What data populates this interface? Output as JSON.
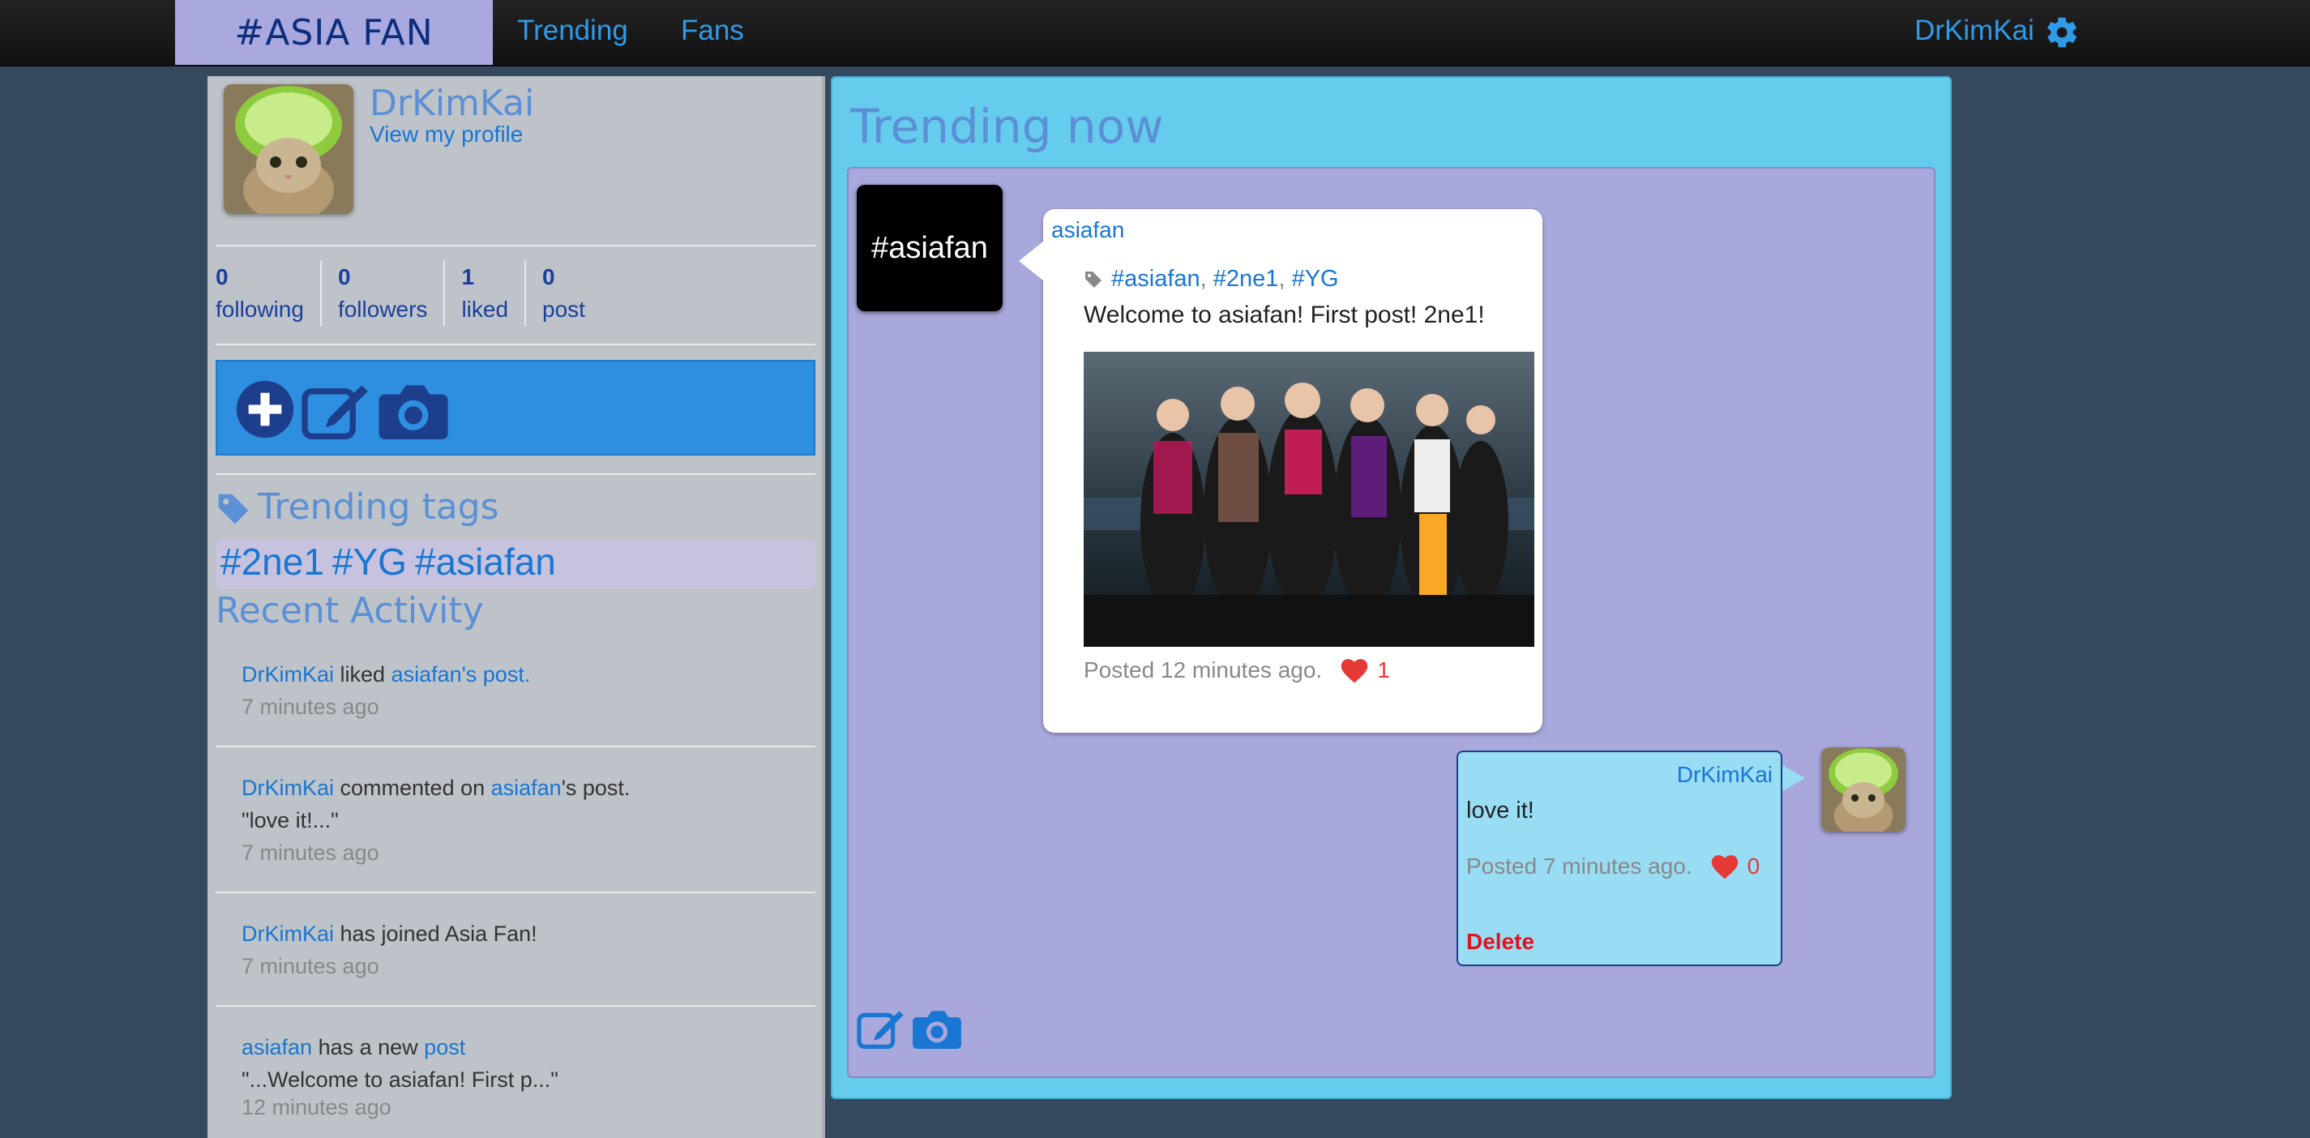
{
  "nav": {
    "brand": "#ASIA FAN",
    "links": [
      "Trending",
      "Fans"
    ],
    "user": "DrKimKai",
    "icons": {
      "settings": "gear-icon"
    }
  },
  "sidebar": {
    "username": "DrKimKai",
    "profile_link": "View my profile",
    "stats": [
      {
        "num": "0",
        "label": "following"
      },
      {
        "num": "0",
        "label": "followers"
      },
      {
        "num": "1",
        "label": "liked"
      },
      {
        "num": "0",
        "label": "post"
      }
    ],
    "actions": [
      "plus-circle-icon",
      "edit-icon",
      "camera-icon"
    ],
    "trending_title": "Trending tags",
    "trending_tags": [
      "#2ne1",
      "#YG",
      "#asiafan"
    ],
    "recent_title": "Recent Activity",
    "activity": [
      {
        "user": "DrKimKai",
        "verb": " liked ",
        "target": "asiafan's post.",
        "time": "7 minutes ago"
      },
      {
        "user": "DrKimKai",
        "verb": " commented on ",
        "target": "asiafan",
        "suffix": "'s post.",
        "quote": "\"love it!...\"",
        "time": "7 minutes ago"
      },
      {
        "user": "DrKimKai",
        "verb": " has joined Asia Fan!",
        "time": "7 minutes ago"
      },
      {
        "user": "asiafan",
        "verb": " has a new ",
        "target": "post",
        "quote": "\"...Welcome to asiafan! First p...\"",
        "time": "12 minutes ago"
      }
    ]
  },
  "main": {
    "title": "Trending now",
    "tag_avatar": "#asiafan",
    "post": {
      "user": "asiafan",
      "tags": [
        "#asiafan",
        "#2ne1",
        "#YG"
      ],
      "text": "Welcome to asiafan! First post! 2ne1!",
      "meta": "Posted 12 minutes ago.",
      "likes": "1"
    },
    "reply": {
      "user": "DrKimKai",
      "text": "love it!",
      "meta": "Posted 7 minutes ago.",
      "likes": "0",
      "delete": "Delete"
    },
    "colors": {
      "accent": "#2f9be8",
      "like": "#e53935",
      "delete": "#e0141e"
    }
  }
}
